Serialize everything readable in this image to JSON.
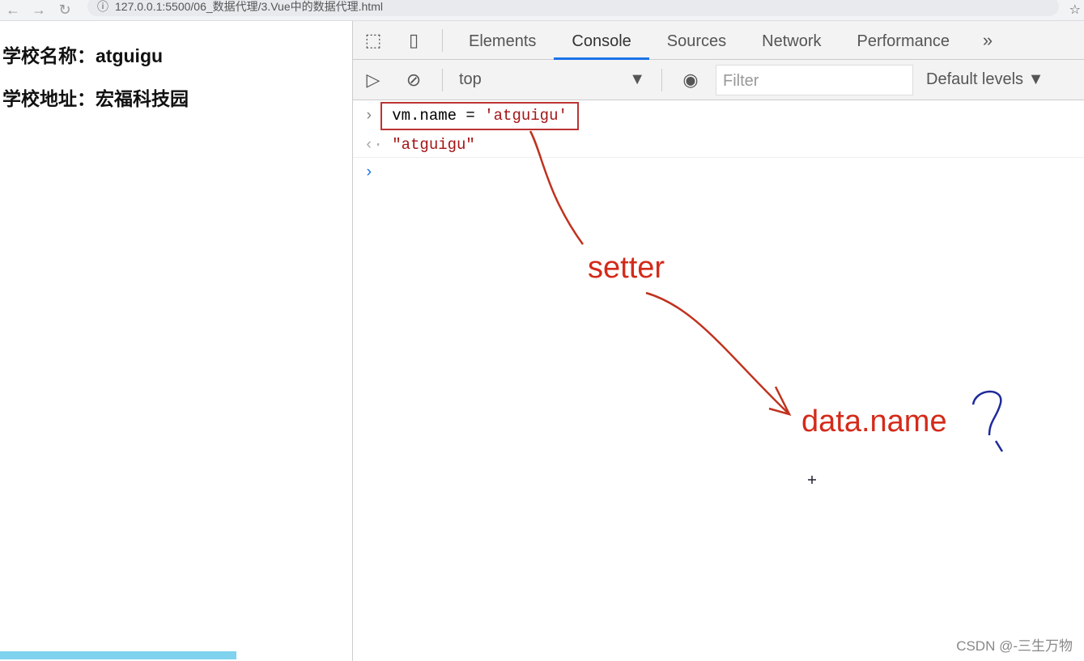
{
  "browser": {
    "url": "127.0.0.1:5500/06_数据代理/3.Vue中的数据代理.html"
  },
  "page": {
    "school_name": "学校名称：atguigu",
    "school_address": "学校地址：宏福科技园"
  },
  "devtools": {
    "tabs": [
      "Elements",
      "Console",
      "Sources",
      "Network",
      "Performance"
    ],
    "active_tab": "Console",
    "context": "top",
    "filter_placeholder": "Filter",
    "levels": "Default levels",
    "console": {
      "input_code": "vm.name = ",
      "input_string": "'atguigu'",
      "output": "\"atguigu\""
    }
  },
  "annotations": {
    "setter": "setter",
    "data_name": "data.name",
    "question": "?",
    "color": "#d42a1a"
  },
  "watermark": "CSDN @-三生万物"
}
